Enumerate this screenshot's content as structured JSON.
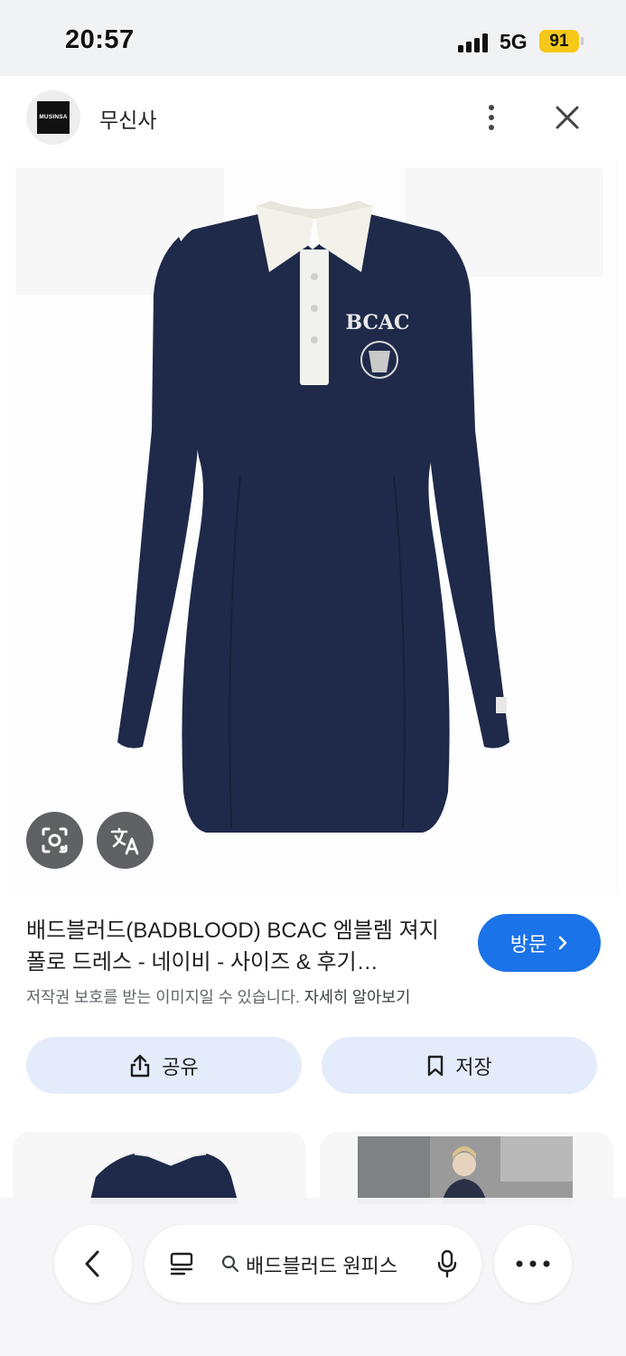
{
  "status_bar": {
    "time": "20:57",
    "network": "5G",
    "battery": "91"
  },
  "header": {
    "site_name": "무신사",
    "logo_text": "MUSINSA"
  },
  "image": {
    "emblem_text": "BCAC",
    "dress_color": "#1f2a4a"
  },
  "result": {
    "title": "배드블러드(BADBLOOD) BCAC 엠블렘 져지 폴로 드레스 - 네이비 - 사이즈 & 후기…",
    "visit_label": "방문",
    "copyright_text": "저작권 보호를 받는 이미지일 수 있습니다.",
    "learn_more": "자세히 알아보기"
  },
  "actions": {
    "share_label": "공유",
    "save_label": "저장"
  },
  "bottom_bar": {
    "search_query": "배드블러드 원피스"
  },
  "colors": {
    "accent": "#1a73e8",
    "action_bg": "#e4ecfb",
    "battery": "#f5c819"
  }
}
